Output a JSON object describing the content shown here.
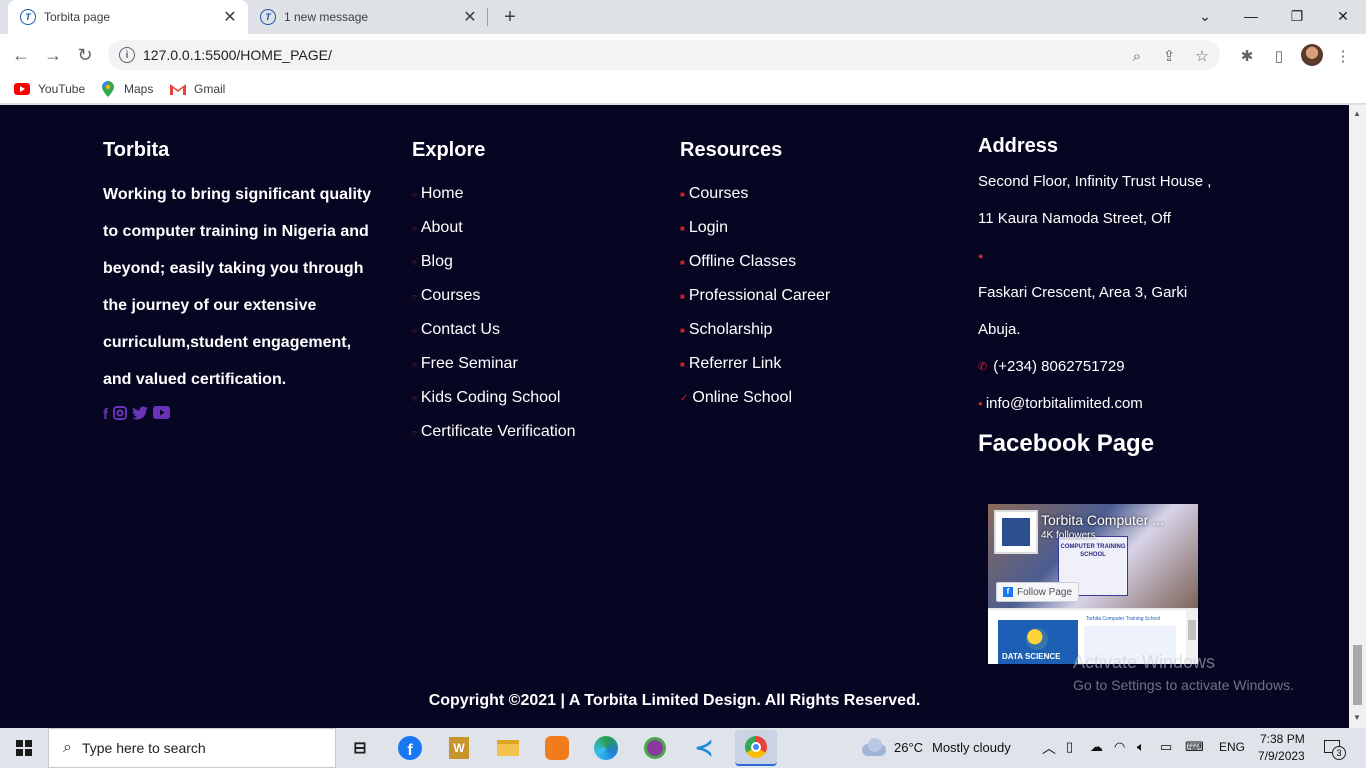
{
  "browser": {
    "tabs": [
      {
        "title": "Torbita page",
        "active": true
      },
      {
        "title": "1 new message",
        "active": false
      }
    ],
    "address": "127.0.0.1:5500/HOME_PAGE/",
    "bookmarks": [
      {
        "label": "YouTube",
        "icon": "youtube-icon"
      },
      {
        "label": "Maps",
        "icon": "maps-icon"
      },
      {
        "label": "Gmail",
        "icon": "gmail-icon"
      }
    ]
  },
  "footer": {
    "brand": {
      "title": "Torbita",
      "lines": [
        "Working to bring significant quality",
        "to computer training in Nigeria and",
        "beyond; easily taking you through",
        "the journey of our extensive",
        "curriculum,student engagement,",
        "and valued certification."
      ],
      "socials": [
        "facebook-icon",
        "instagram-icon",
        "twitter-icon",
        "youtube-icon"
      ]
    },
    "explore": {
      "title": "Explore",
      "items": [
        "Home",
        "About",
        "Blog",
        "Courses",
        "Contact Us",
        "Free Seminar",
        "Kids Coding School",
        "Certificate Verification"
      ]
    },
    "resources": {
      "title": "Resources",
      "items": [
        "Courses",
        "Login",
        "Offline Classes",
        "Professional Career",
        "Scholarship",
        "Referrer Link",
        "Online School"
      ]
    },
    "address": {
      "title": "Address",
      "line1": "Second Floor, Infinity Trust House ,",
      "line2": "11 Kaura Namoda Street, Off",
      "line3": "Faskari Crescent, Area 3, Garki",
      "line4": "Abuja.",
      "phone": "(+234) 8062751729",
      "email": "info@torbitalimited.com"
    },
    "facebook": {
      "title": "Facebook Page",
      "page_name": "Torbita Computer ...",
      "followers": "4K followers",
      "follow_label": "Follow Page",
      "banner_text": "COMPUTER TRAINING SCHOOL",
      "post_label": "Torbita Computer Training School",
      "post_caption": "DATA SCIENCE"
    },
    "copyright": "Copyright ©2021 | A Torbita Limited Design. All Rights Reserved."
  },
  "watermark": {
    "title": "Activate Windows",
    "subtitle": "Go to Settings to activate Windows."
  },
  "taskbar": {
    "search_placeholder": "Type here to search",
    "weather_temp": "26°C",
    "weather_text": "Mostly cloudy",
    "language": "ENG",
    "time": "7:38 PM",
    "date": "7/9/2023",
    "notifications": "3"
  },
  "colors": {
    "page_bg": "#060622",
    "social_purple": "#6a32b8",
    "bullet_red": "#d0202a"
  }
}
